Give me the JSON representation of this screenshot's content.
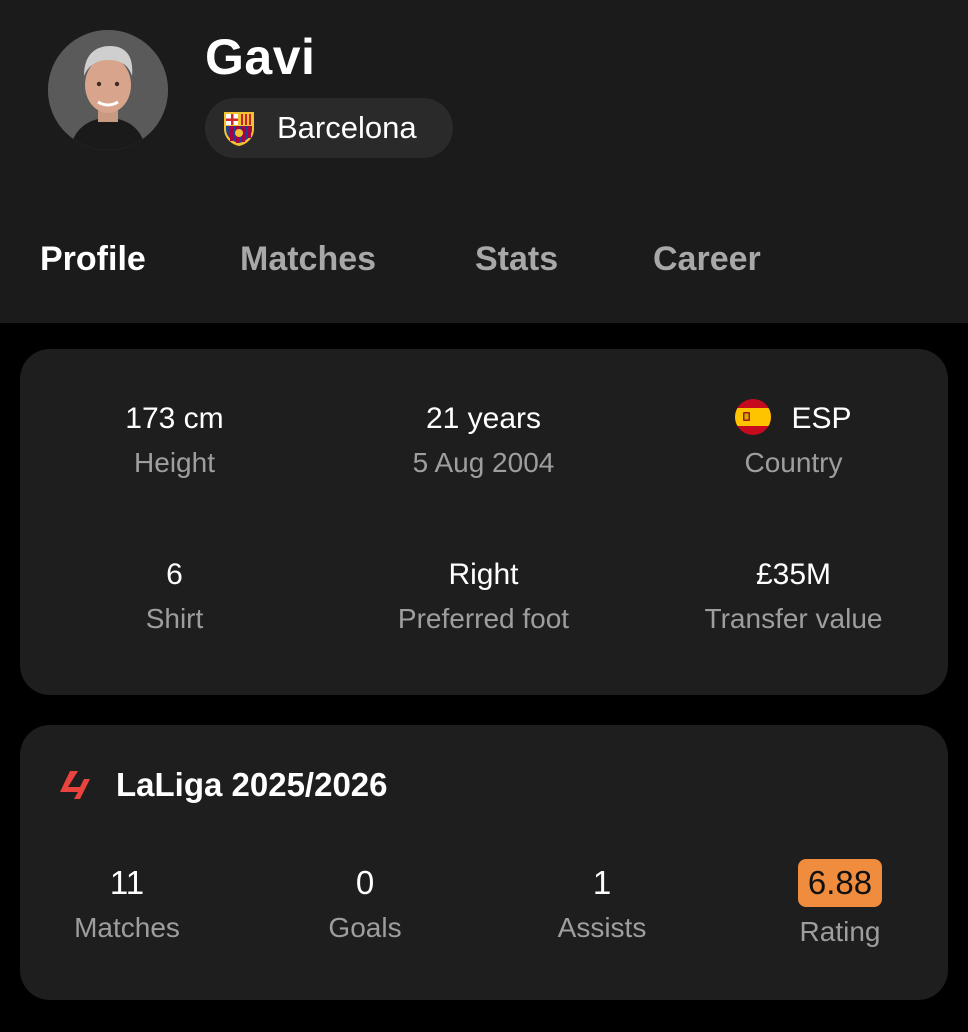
{
  "player": {
    "name": "Gavi",
    "team": "Barcelona"
  },
  "tabs": [
    {
      "label": "Profile",
      "active": true
    },
    {
      "label": "Matches",
      "active": false
    },
    {
      "label": "Stats",
      "active": false
    },
    {
      "label": "Career",
      "active": false
    }
  ],
  "profile": {
    "height": {
      "value": "173 cm",
      "label": "Height"
    },
    "age": {
      "value": "21 years",
      "label": "5 Aug 2004"
    },
    "country": {
      "value": "ESP",
      "label": "Country",
      "flag_icon": "spain-flag-icon"
    },
    "shirt": {
      "value": "6",
      "label": "Shirt"
    },
    "foot": {
      "value": "Right",
      "label": "Preferred foot"
    },
    "transfer": {
      "value": "£35M",
      "label": "Transfer value"
    }
  },
  "league": {
    "name": "LaLiga 2025/2026",
    "logo_icon": "laliga-logo-icon",
    "stats": [
      {
        "value": "11",
        "label": "Matches"
      },
      {
        "value": "0",
        "label": "Goals"
      },
      {
        "value": "1",
        "label": "Assists"
      },
      {
        "value": "6.88",
        "label": "Rating",
        "highlight_color": "#f08c3e"
      }
    ]
  },
  "colors": {
    "header_bg": "#1b1b1b",
    "card_bg": "#1e1e1e",
    "rating_accent": "#f08c3e",
    "muted_text": "#9e9e9e"
  }
}
